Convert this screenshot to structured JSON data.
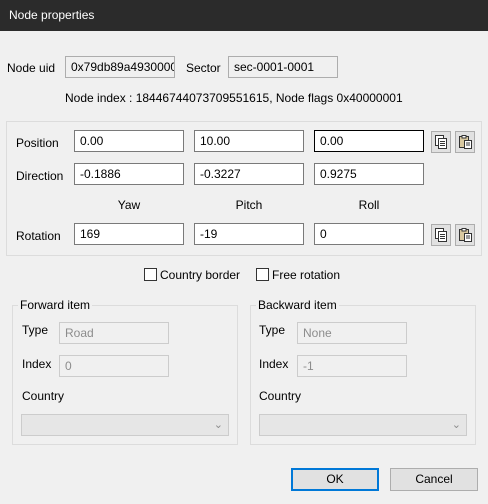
{
  "window": {
    "title": "Node properties"
  },
  "node": {
    "uid_label": "Node uid",
    "uid_value": "0x79db89a493000000",
    "sector_label": "Sector",
    "sector_value": "sec-0001-0001",
    "index_line": "Node index : 18446744073709551615, Node flags 0x40000001"
  },
  "transform": {
    "position_label": "Position",
    "position": [
      "0.00",
      "10.00",
      "0.00"
    ],
    "direction_label": "Direction",
    "direction": [
      "-0.1886",
      "-0.3227",
      "0.9275"
    ],
    "column_headers": [
      "Yaw",
      "Pitch",
      "Roll"
    ],
    "rotation_label": "Rotation",
    "rotation": [
      "169",
      "-19",
      "0"
    ],
    "copy_icon": "copy-icon",
    "paste_icon": "paste-icon"
  },
  "options": {
    "country_border_label": "Country border",
    "country_border_checked": false,
    "free_rotation_label": "Free rotation",
    "free_rotation_checked": false
  },
  "forward": {
    "group_label": "Forward item",
    "type_label": "Type",
    "type_value": "Road",
    "index_label": "Index",
    "index_value": "0",
    "country_label": "Country",
    "country_value": ""
  },
  "backward": {
    "group_label": "Backward item",
    "type_label": "Type",
    "type_value": "None",
    "index_label": "Index",
    "index_value": "-1",
    "country_label": "Country",
    "country_value": ""
  },
  "buttons": {
    "ok": "OK",
    "cancel": "Cancel"
  }
}
